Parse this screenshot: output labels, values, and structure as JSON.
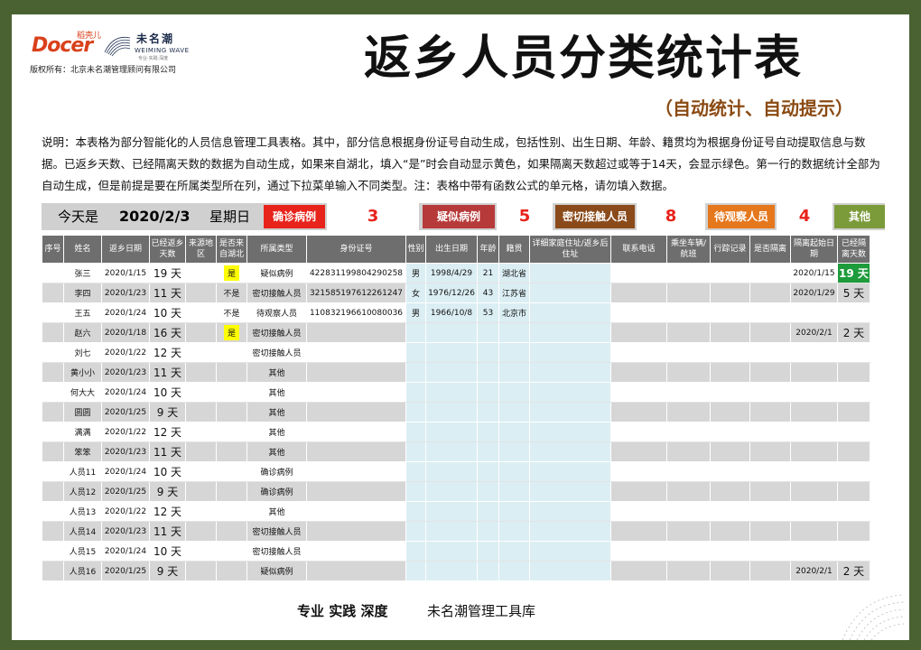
{
  "brand": {
    "docer": "Docer",
    "docer_cn": "稻壳儿",
    "weiming_cn": "未名潮",
    "weiming_en": "WEIMING WAVE",
    "weiming_sub": "专业·实践·深度",
    "copyright": "版权所有：北京未名潮管理顾问有限公司"
  },
  "title": "返乡人员分类统计表",
  "subtitle": "（自动统计、自动提示）",
  "description": "说明：本表格为部分智能化的人员信息管理工具表格。其中，部分信息根据身份证号自动生成，包括性别、出生日期、年龄、籍贯均为根据身份证号自动提取信息与数据。已返乡天数、已经隔离天数的数据为自动生成，如果来自湖北，填入“是”时会自动显示黄色，如果隔离天数超过或等于14天，会显示绿色。第一行的数据统计全部为自动生成，但是前提是要在所属类型所在列，通过下拉菜单输入不同类型。注：表格中带有函数公式的单元格，请勿填入数据。",
  "summary": {
    "today_label": "今天是",
    "date": "2020/2/3",
    "weekday": "星期日",
    "categories": [
      {
        "label": "确诊病例",
        "count": "3",
        "color": "#e8231b"
      },
      {
        "label": "疑似病例",
        "count": "5",
        "color": "#b73a3a"
      },
      {
        "label": "密切接触人员",
        "count": "8",
        "color": "#8a4a1a"
      },
      {
        "label": "待观察人员",
        "count": "4",
        "color": "#e5771d"
      },
      {
        "label": "其他",
        "count": "",
        "color": "#7b9a3a"
      }
    ]
  },
  "table": {
    "headers": [
      "序号",
      "姓名",
      "返乡日期",
      "已经返乡天数",
      "来源地区",
      "是否来自湖北",
      "所属类型",
      "身份证号",
      "性别",
      "出生日期",
      "年龄",
      "籍贯",
      "详细家庭住址/返乡后住址",
      "联系电话",
      "乘坐车辆/航班",
      "行踪记录",
      "是否隔离",
      "隔离起始日期",
      "已经隔离天数"
    ],
    "rows": [
      [
        "",
        "张三",
        "2020/1/15",
        "19 天",
        "",
        "是",
        "疑似病例",
        "422831199804290258",
        "男",
        "1998/4/29",
        "21",
        "湖北省",
        "",
        "",
        "",
        "",
        "",
        "2020/1/15",
        "19 天"
      ],
      [
        "",
        "李四",
        "2020/1/23",
        "11 天",
        "",
        "不是",
        "密切接触人员",
        "321585197612261247",
        "女",
        "1976/12/26",
        "43",
        "江苏省",
        "",
        "",
        "",
        "",
        "",
        "2020/1/29",
        "5 天"
      ],
      [
        "",
        "王五",
        "2020/1/24",
        "10 天",
        "",
        "不是",
        "待观察人员",
        "110832196610080036",
        "男",
        "1966/10/8",
        "53",
        "北京市",
        "",
        "",
        "",
        "",
        "",
        "",
        ""
      ],
      [
        "",
        "赵六",
        "2020/1/18",
        "16 天",
        "",
        "是",
        "密切接触人员",
        "",
        "",
        "",
        "",
        "",
        "",
        "",
        "",
        "",
        "",
        "2020/2/1",
        "2 天"
      ],
      [
        "",
        "刘七",
        "2020/1/22",
        "12 天",
        "",
        "",
        "密切接触人员",
        "",
        "",
        "",
        "",
        "",
        "",
        "",
        "",
        "",
        "",
        "",
        ""
      ],
      [
        "",
        "黄小小",
        "2020/1/23",
        "11 天",
        "",
        "",
        "其他",
        "",
        "",
        "",
        "",
        "",
        "",
        "",
        "",
        "",
        "",
        "",
        ""
      ],
      [
        "",
        "何大大",
        "2020/1/24",
        "10 天",
        "",
        "",
        "其他",
        "",
        "",
        "",
        "",
        "",
        "",
        "",
        "",
        "",
        "",
        "",
        ""
      ],
      [
        "",
        "圆圆",
        "2020/1/25",
        "9 天",
        "",
        "",
        "其他",
        "",
        "",
        "",
        "",
        "",
        "",
        "",
        "",
        "",
        "",
        "",
        ""
      ],
      [
        "",
        "满满",
        "2020/1/22",
        "12 天",
        "",
        "",
        "其他",
        "",
        "",
        "",
        "",
        "",
        "",
        "",
        "",
        "",
        "",
        "",
        ""
      ],
      [
        "",
        "笨笨",
        "2020/1/23",
        "11 天",
        "",
        "",
        "其他",
        "",
        "",
        "",
        "",
        "",
        "",
        "",
        "",
        "",
        "",
        "",
        ""
      ],
      [
        "",
        "人员11",
        "2020/1/24",
        "10 天",
        "",
        "",
        "确诊病例",
        "",
        "",
        "",
        "",
        "",
        "",
        "",
        "",
        "",
        "",
        "",
        ""
      ],
      [
        "",
        "人员12",
        "2020/1/25",
        "9 天",
        "",
        "",
        "确诊病例",
        "",
        "",
        "",
        "",
        "",
        "",
        "",
        "",
        "",
        "",
        "",
        ""
      ],
      [
        "",
        "人员13",
        "2020/1/22",
        "12 天",
        "",
        "",
        "其他",
        "",
        "",
        "",
        "",
        "",
        "",
        "",
        "",
        "",
        "",
        "",
        ""
      ],
      [
        "",
        "人员14",
        "2020/1/23",
        "11 天",
        "",
        "",
        "密切接触人员",
        "",
        "",
        "",
        "",
        "",
        "",
        "",
        "",
        "",
        "",
        "",
        ""
      ],
      [
        "",
        "人员15",
        "2020/1/24",
        "10 天",
        "",
        "",
        "密切接触人员",
        "",
        "",
        "",
        "",
        "",
        "",
        "",
        "",
        "",
        "",
        "",
        ""
      ],
      [
        "",
        "人员16",
        "2020/1/25",
        "9 天",
        "",
        "",
        "疑似病例",
        "",
        "",
        "",
        "",
        "",
        "",
        "",
        "",
        "",
        "",
        "2020/2/1",
        "2 天"
      ]
    ]
  },
  "footer": {
    "slogan": "专业  实践  深度",
    "library": "未名潮管理工具库"
  },
  "colors": {
    "frame": "#4a6232",
    "hubei_yes": "#ffff00",
    "iso_over_14": "#1e9b3b",
    "auto_cols": "#dbeef4"
  }
}
